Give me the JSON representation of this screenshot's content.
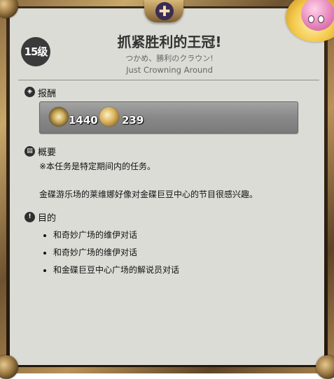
{
  "level": "15级",
  "quest": {
    "title": "抓紧胜利的王冠!",
    "subtitle_jp": "つかめ、勝利のクラウン!",
    "subtitle_en": "Just Crowning Around"
  },
  "rewards": {
    "label": "报酬",
    "items": [
      {
        "icon": "exp-icon",
        "value": "1440"
      },
      {
        "icon": "gil-coin-icon",
        "value": "239"
      }
    ]
  },
  "summary": {
    "label": "概要",
    "line1": "※本任务是特定期间内的任务。",
    "line2": "金碟游乐场的莱维娜好像对金碟巨豆中心的节目很感兴趣。"
  },
  "objectives": {
    "label": "目的",
    "items": [
      "和奇妙广场的维伊对话",
      "和奇妙广场的维伊对话",
      "和金碟巨豆中心广场的解说员对话"
    ]
  },
  "colors": {
    "panel": "#dcdcd6",
    "frame_gold": "#c9a86a",
    "badge": "#3a3a3a",
    "reward_box": "#888888"
  }
}
